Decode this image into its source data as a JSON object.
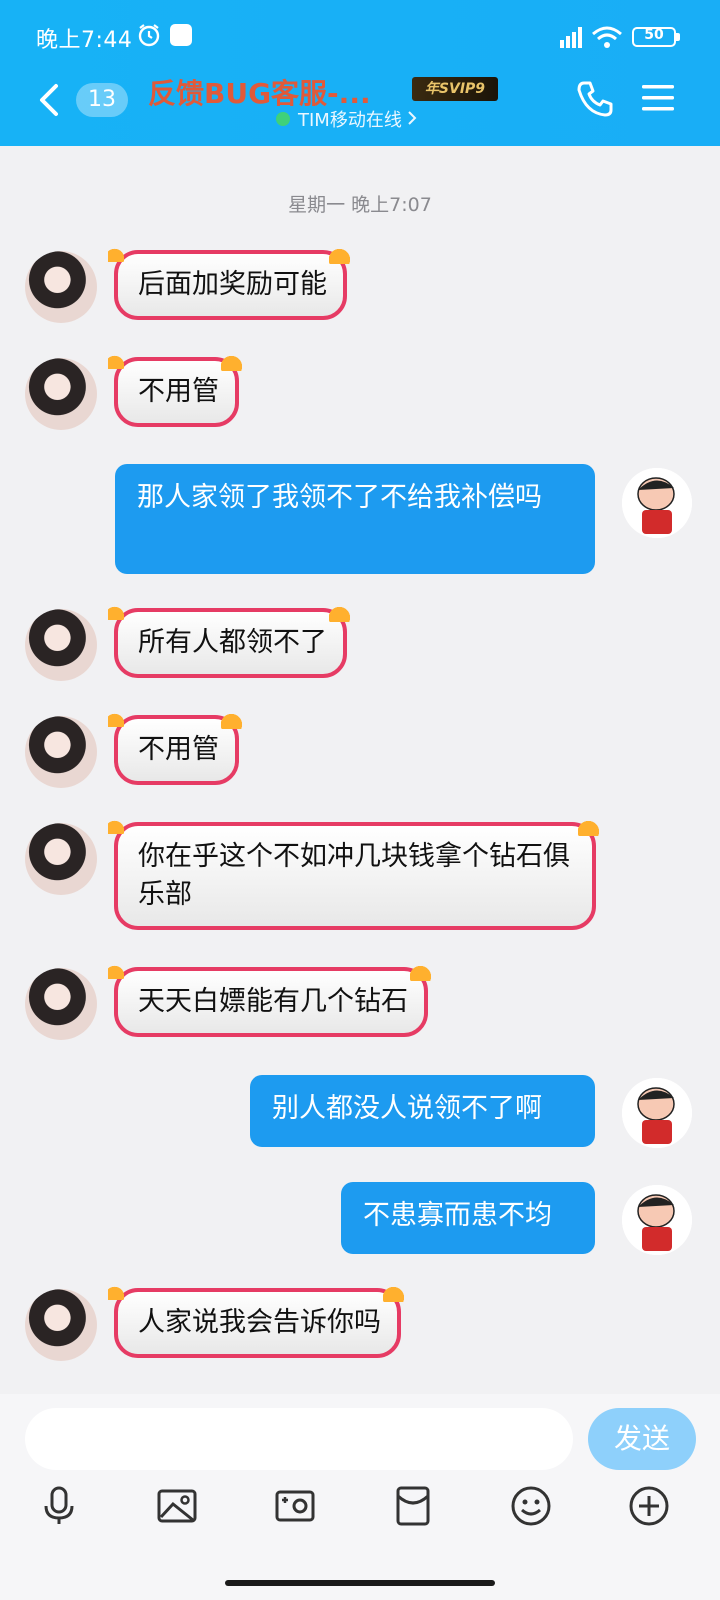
{
  "status_bar": {
    "time": "晚上7:44",
    "battery": "50"
  },
  "header": {
    "unread_count": "13",
    "title": "反馈BUG客服-...",
    "badge": "年SVIP9",
    "online_status": "TIM移动在线"
  },
  "chat": {
    "time_label": "星期一 晚上7:07",
    "messages": [
      {
        "side": "in",
        "text": "后面加奖励可能"
      },
      {
        "side": "in",
        "text": "不用管"
      },
      {
        "side": "out",
        "text": "那人家领了我领不了不给我补偿吗"
      },
      {
        "side": "in",
        "text": "所有人都领不了"
      },
      {
        "side": "in",
        "text": "不用管"
      },
      {
        "side": "in",
        "text": "你在乎这个不如冲几块钱拿个钻石俱乐部"
      },
      {
        "side": "in",
        "text": "天天白嫖能有几个钻石"
      },
      {
        "side": "out",
        "text": "别人都没人说领不了啊"
      },
      {
        "side": "out",
        "text": "不患寡而患不均"
      },
      {
        "side": "in",
        "text": "人家说我会告诉你吗"
      }
    ]
  },
  "input_bar": {
    "send_label": "发送",
    "placeholder": ""
  },
  "colors": {
    "header": "#17b2f6",
    "out_bubble": "#1d9bf0",
    "in_bubble_border": "#e63b64"
  }
}
